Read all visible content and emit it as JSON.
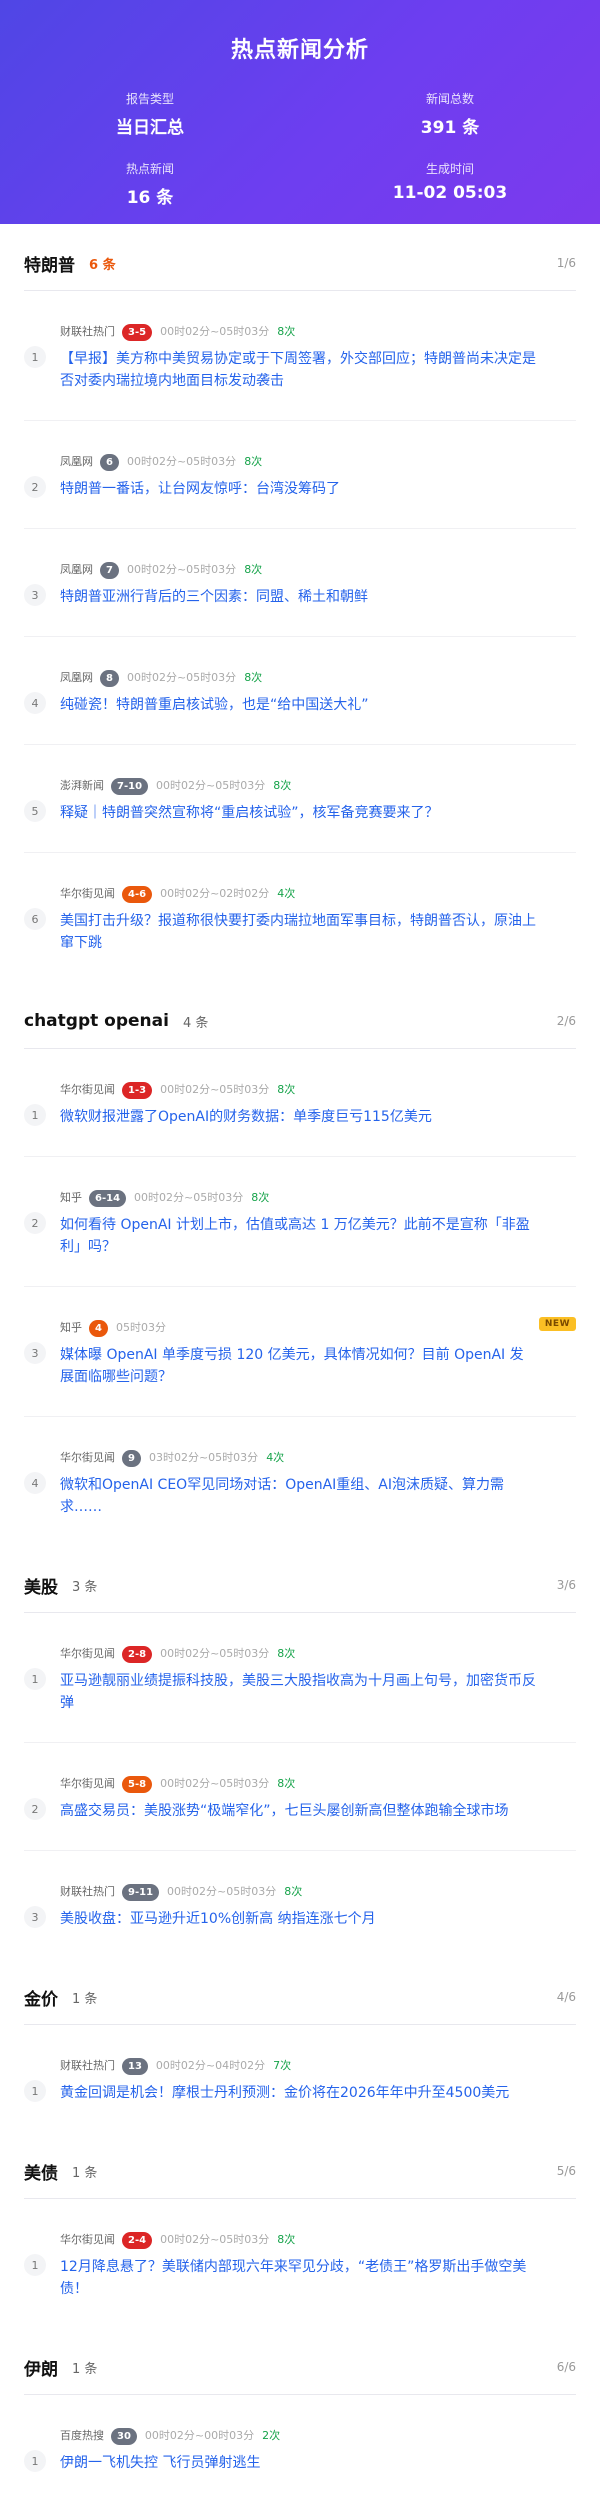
{
  "header": {
    "title": "热点新闻分析",
    "stats": [
      {
        "label": "报告类型",
        "value": "当日汇总"
      },
      {
        "label": "新闻总数",
        "value": "391 条"
      },
      {
        "label": "热点新闻",
        "value": "16 条"
      },
      {
        "label": "生成时间",
        "value": "11-02 05:03"
      }
    ]
  },
  "sections": [
    {
      "title": "特朗普",
      "count": "6 条",
      "page": "1/6",
      "hot": true,
      "items": [
        {
          "rank": "1",
          "source": "财联社热门",
          "badge": "3-5",
          "badge_color": "red",
          "time": "00时02分~05时03分",
          "freq": "8次",
          "title": "【早报】美方称中美贸易协定或于下周签署，外交部回应；特朗普尚未决定是否对委内瑞拉境内地面目标发动袭击",
          "is_new": false
        },
        {
          "rank": "2",
          "source": "凤凰网",
          "badge": "6",
          "badge_color": "gray",
          "time": "00时02分~05时03分",
          "freq": "8次",
          "title": "特朗普一番话，让台网友惊呼：台湾没筹码了",
          "is_new": false
        },
        {
          "rank": "3",
          "source": "凤凰网",
          "badge": "7",
          "badge_color": "gray",
          "time": "00时02分~05时03分",
          "freq": "8次",
          "title": "特朗普亚洲行背后的三个因素：同盟、稀土和朝鲜",
          "is_new": false
        },
        {
          "rank": "4",
          "source": "凤凰网",
          "badge": "8",
          "badge_color": "gray",
          "time": "00时02分~05时03分",
          "freq": "8次",
          "title": "纯碰瓷！特朗普重启核试验，也是“给中国送大礼”",
          "is_new": false
        },
        {
          "rank": "5",
          "source": "澎湃新闻",
          "badge": "7-10",
          "badge_color": "gray",
          "time": "00时02分~05时03分",
          "freq": "8次",
          "title": "释疑｜特朗普突然宣称将“重启核试验”，核军备竞赛要来了？",
          "is_new": false
        },
        {
          "rank": "6",
          "source": "华尔街见闻",
          "badge": "4-6",
          "badge_color": "orange",
          "time": "00时02分~02时02分",
          "freq": "4次",
          "title": "美国打击升级？报道称很快要打委内瑞拉地面军事目标，特朗普否认，原油上窜下跳",
          "is_new": false
        }
      ]
    },
    {
      "title": "chatgpt openai",
      "count": "4 条",
      "page": "2/6",
      "hot": false,
      "items": [
        {
          "rank": "1",
          "source": "华尔街见闻",
          "badge": "1-3",
          "badge_color": "red",
          "time": "00时02分~05时03分",
          "freq": "8次",
          "title": "微软财报泄露了OpenAI的财务数据：单季度巨亏115亿美元",
          "is_new": false
        },
        {
          "rank": "2",
          "source": "知乎",
          "badge": "6-14",
          "badge_color": "gray",
          "time": "00时02分~05时03分",
          "freq": "8次",
          "title": "如何看待 OpenAI 计划上市，估值或高达 1 万亿美元？此前不是宣称「非盈利」吗？",
          "is_new": false
        },
        {
          "rank": "3",
          "source": "知乎",
          "badge": "4",
          "badge_color": "orange",
          "time": "05时03分",
          "freq": "",
          "title": "媒体曝 OpenAI 单季度亏损 120 亿美元，具体情况如何？目前 OpenAI 发展面临哪些问题？",
          "is_new": true,
          "new_label": "NEW"
        },
        {
          "rank": "4",
          "source": "华尔街见闻",
          "badge": "9",
          "badge_color": "gray",
          "time": "03时02分~05时03分",
          "freq": "4次",
          "title": "微软和OpenAI CEO罕见同场对话：OpenAI重组、AI泡沫质疑、算力需求……",
          "is_new": false
        }
      ]
    },
    {
      "title": "美股",
      "count": "3 条",
      "page": "3/6",
      "hot": false,
      "items": [
        {
          "rank": "1",
          "source": "华尔街见闻",
          "badge": "2-8",
          "badge_color": "red",
          "time": "00时02分~05时03分",
          "freq": "8次",
          "title": "亚马逊靓丽业绩提振科技股，美股三大股指收高为十月画上句号，加密货币反弹",
          "is_new": false
        },
        {
          "rank": "2",
          "source": "华尔街见闻",
          "badge": "5-8",
          "badge_color": "orange",
          "time": "00时02分~05时03分",
          "freq": "8次",
          "title": "高盛交易员：美股涨势“极端窄化”，七巨头屡创新高但整体跑输全球市场",
          "is_new": false
        },
        {
          "rank": "3",
          "source": "财联社热门",
          "badge": "9-11",
          "badge_color": "gray",
          "time": "00时02分~05时03分",
          "freq": "8次",
          "title": "美股收盘：亚马逊升近10%创新高 纳指连涨七个月",
          "is_new": false
        }
      ]
    },
    {
      "title": "金价",
      "count": "1 条",
      "page": "4/6",
      "hot": false,
      "items": [
        {
          "rank": "1",
          "source": "财联社热门",
          "badge": "13",
          "badge_color": "gray",
          "time": "00时02分~04时02分",
          "freq": "7次",
          "title": "黄金回调是机会！摩根士丹利预测：金价将在2026年年中升至4500美元",
          "is_new": false
        }
      ]
    },
    {
      "title": "美债",
      "count": "1 条",
      "page": "5/6",
      "hot": false,
      "items": [
        {
          "rank": "1",
          "source": "华尔街见闻",
          "badge": "2-4",
          "badge_color": "red",
          "time": "00时02分~05时03分",
          "freq": "8次",
          "title": "12月降息悬了？美联储内部现六年来罕见分歧，“老债王”格罗斯出手做空美债！",
          "is_new": false
        }
      ]
    },
    {
      "title": "伊朗",
      "count": "1 条",
      "page": "6/6",
      "hot": false,
      "items": [
        {
          "rank": "1",
          "source": "百度热搜",
          "badge": "30",
          "badge_color": "gray",
          "time": "00时02分~00时03分",
          "freq": "2次",
          "title": "伊朗一飞机失控 飞行员弹射逃生",
          "is_new": false
        }
      ]
    }
  ]
}
